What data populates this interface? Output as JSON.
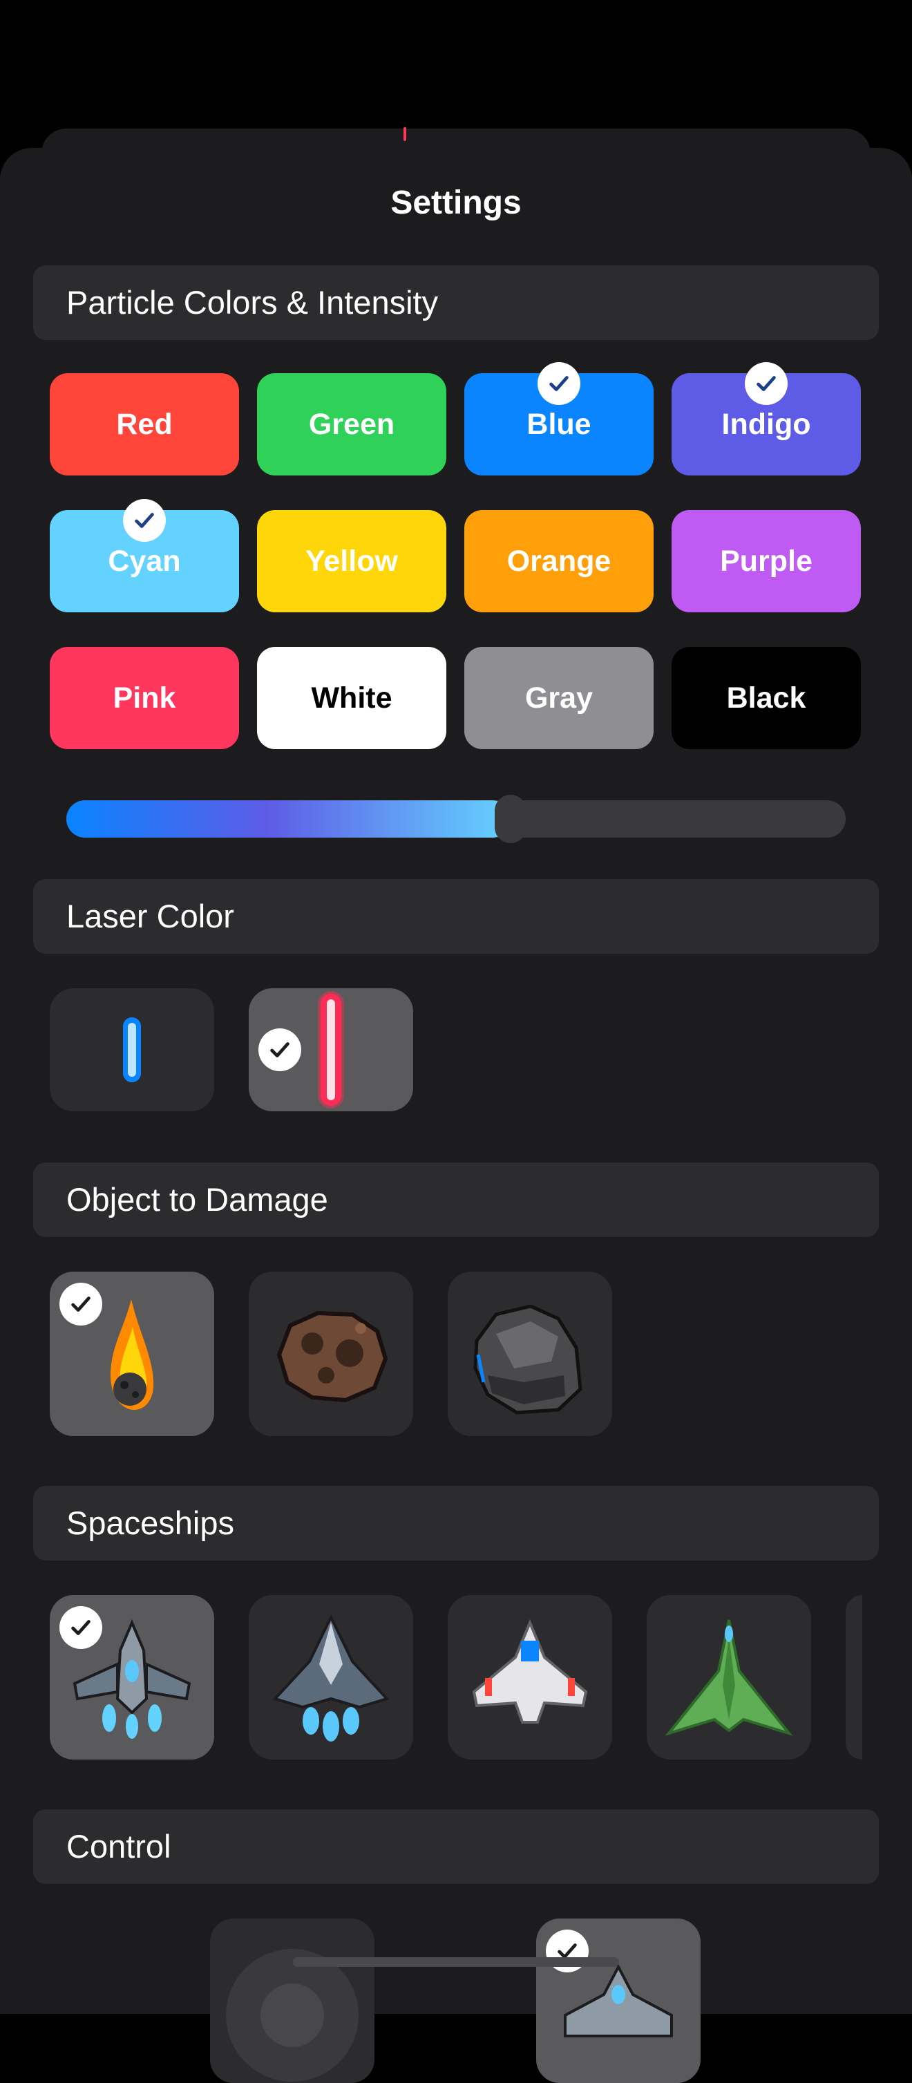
{
  "header": {
    "title": "Settings"
  },
  "sections": {
    "particle": "Particle Colors & Intensity",
    "laser": "Laser Color",
    "object": "Object to Damage",
    "spaceships": "Spaceships",
    "control": "Control"
  },
  "particle_colors": [
    {
      "label": "Red",
      "bg": "#ff453a",
      "fg": "#ffffff",
      "selected": false
    },
    {
      "label": "Green",
      "bg": "#30d158",
      "fg": "#ffffff",
      "selected": false
    },
    {
      "label": "Blue",
      "bg": "#0a84ff",
      "fg": "#ffffff",
      "selected": true
    },
    {
      "label": "Indigo",
      "bg": "#5e5ce6",
      "fg": "#ffffff",
      "selected": true
    },
    {
      "label": "Cyan",
      "bg": "#64d2ff",
      "fg": "#ffffff",
      "selected": true
    },
    {
      "label": "Yellow",
      "bg": "#ffd60a",
      "fg": "#ffffff",
      "selected": false
    },
    {
      "label": "Orange",
      "bg": "#ff9f0a",
      "fg": "#ffffff",
      "selected": false
    },
    {
      "label": "Purple",
      "bg": "#bf5af2",
      "fg": "#ffffff",
      "selected": false
    },
    {
      "label": "Pink",
      "bg": "#ff375f",
      "fg": "#ffffff",
      "selected": false
    },
    {
      "label": "White",
      "bg": "#ffffff",
      "fg": "#000000",
      "selected": false
    },
    {
      "label": "Gray",
      "bg": "#8e8e93",
      "fg": "#ffffff",
      "selected": false
    },
    {
      "label": "Black",
      "bg": "#000000",
      "fg": "#ffffff",
      "selected": false
    }
  ],
  "intensity": {
    "value": 0.57
  },
  "laser_options": [
    {
      "name": "blue-laser",
      "color": "#0a84ff",
      "selected": false
    },
    {
      "name": "red-laser",
      "color": "#ff2d55",
      "selected": true
    }
  ],
  "objects": [
    {
      "name": "flaming-meteor",
      "selected": true
    },
    {
      "name": "brown-asteroid",
      "selected": false
    },
    {
      "name": "gray-rock",
      "selected": false
    }
  ],
  "spaceships": [
    {
      "name": "cyan-fighter",
      "selected": true
    },
    {
      "name": "steel-fighter",
      "selected": false
    },
    {
      "name": "white-blue-ship",
      "selected": false
    },
    {
      "name": "green-ship",
      "selected": false
    }
  ],
  "accent": "#1c3f8a"
}
